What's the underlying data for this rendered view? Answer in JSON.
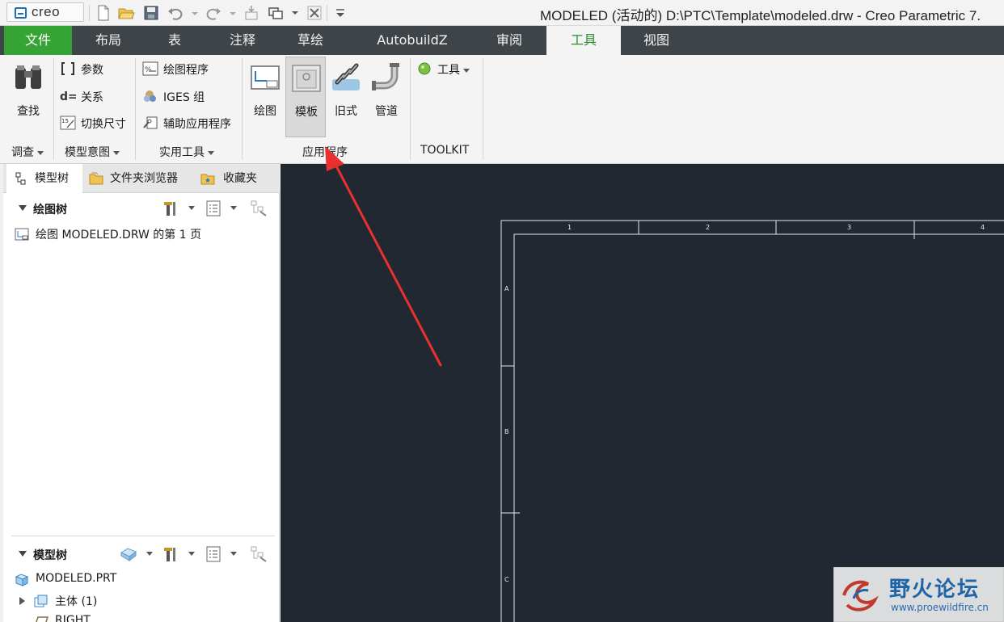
{
  "window": {
    "app_logo_text": "creo",
    "title": "MODELED (活动的) D:\\PTC\\Template\\modeled.drw - Creo Parametric 7."
  },
  "tabs": [
    {
      "label": "文件"
    },
    {
      "label": "布局"
    },
    {
      "label": "表"
    },
    {
      "label": "注释"
    },
    {
      "label": "草绘"
    },
    {
      "label": "AutobuildZ"
    },
    {
      "label": "审阅"
    },
    {
      "label": "工具"
    },
    {
      "label": "视图"
    }
  ],
  "active_tab": "工具",
  "ribbon": {
    "investigate": {
      "find_label": "查找",
      "group_label": "调查"
    },
    "model_intent": {
      "parameters": "参数",
      "relations": "关系",
      "switch_dims": "切换尺寸",
      "group_label": "模型意图"
    },
    "utilities": {
      "drawing_program": "绘图程序",
      "iges_group": "IGES 组",
      "aux_apps": "辅助应用程序",
      "group_label": "实用工具"
    },
    "applications": {
      "drawing": "绘图",
      "template": "模板",
      "legacy": "旧式",
      "piping": "管道",
      "group_label": "应用程序"
    },
    "toolkit": {
      "tools": "工具",
      "group_label": "TOOLKIT"
    }
  },
  "panel": {
    "tabs": [
      {
        "label": "模型树"
      },
      {
        "label": "文件夹浏览器"
      },
      {
        "label": "收藏夹"
      }
    ],
    "drawing_tree": {
      "title": "绘图树",
      "items": [
        {
          "label": "绘图 MODELED.DRW 的第 1 页"
        }
      ]
    },
    "model_tree": {
      "title": "模型树",
      "items": [
        {
          "label": "MODELED.PRT"
        },
        {
          "label": "主体 (1)"
        },
        {
          "label": "RIGHT"
        }
      ]
    }
  },
  "drawing": {
    "top_zones": [
      "1",
      "2",
      "3",
      "4"
    ],
    "left_zones": [
      "A",
      "B",
      "C"
    ]
  },
  "watermark": {
    "cn": "野火论坛",
    "en": "www.proewildfire.cn"
  },
  "colors": {
    "file_tab": "#35a434",
    "active_tab_text": "#2c8a2c",
    "canvas_bg": "#222831",
    "annotation_arrow": "#e8312f"
  }
}
